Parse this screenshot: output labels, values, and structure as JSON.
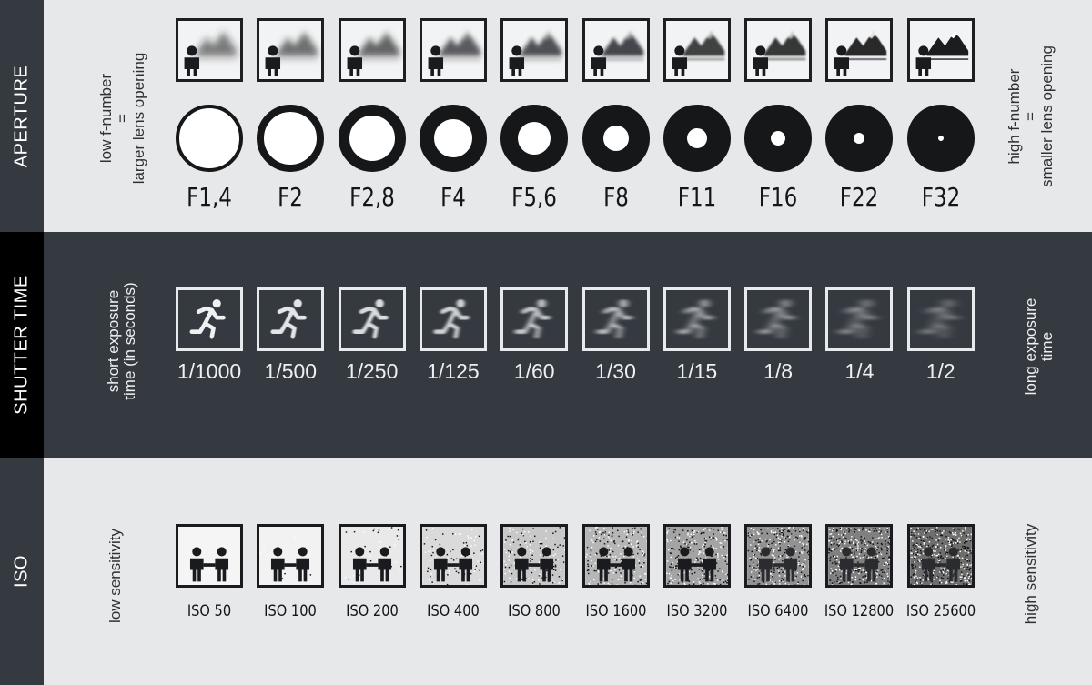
{
  "aperture": {
    "title": "APERTURE",
    "left_note": [
      "low f-number",
      "=",
      "larger lens opening"
    ],
    "right_note": [
      "high f-number",
      "=",
      "smaller lens opening"
    ],
    "stops": [
      {
        "label": "F1,4",
        "blur": 0.95,
        "ring": 0.06
      },
      {
        "label": "F2",
        "blur": 0.85,
        "ring": 0.12
      },
      {
        "label": "F2,8",
        "blur": 0.75,
        "ring": 0.17
      },
      {
        "label": "F4",
        "blur": 0.65,
        "ring": 0.22
      },
      {
        "label": "F5,6",
        "blur": 0.55,
        "ring": 0.27
      },
      {
        "label": "F8",
        "blur": 0.45,
        "ring": 0.32
      },
      {
        "label": "F11",
        "blur": 0.35,
        "ring": 0.36
      },
      {
        "label": "F16",
        "blur": 0.25,
        "ring": 0.4
      },
      {
        "label": "F22",
        "blur": 0.12,
        "ring": 0.43
      },
      {
        "label": "F32",
        "blur": 0.0,
        "ring": 0.46
      }
    ]
  },
  "shutter": {
    "title": "SHUTTER TIME",
    "left_note": [
      "short exposure",
      "time (in seconds)"
    ],
    "right_note": [
      "long exposure",
      "time"
    ],
    "speeds": [
      {
        "label": "1/1000",
        "blur": 0.0
      },
      {
        "label": "1/500",
        "blur": 0.1
      },
      {
        "label": "1/250",
        "blur": 0.2
      },
      {
        "label": "1/125",
        "blur": 0.3
      },
      {
        "label": "1/60",
        "blur": 0.42
      },
      {
        "label": "1/30",
        "blur": 0.55
      },
      {
        "label": "1/15",
        "blur": 0.68
      },
      {
        "label": "1/8",
        "blur": 0.8
      },
      {
        "label": "1/4",
        "blur": 0.9
      },
      {
        "label": "1/2",
        "blur": 1.0
      }
    ]
  },
  "iso": {
    "title": "ISO",
    "left_note": [
      "low sensitivity"
    ],
    "right_note": [
      "high sensitivity"
    ],
    "values": [
      {
        "label": "ISO 50",
        "noise": 0.0
      },
      {
        "label": "ISO 100",
        "noise": 0.02
      },
      {
        "label": "ISO 200",
        "noise": 0.08
      },
      {
        "label": "ISO 400",
        "noise": 0.18
      },
      {
        "label": "ISO 800",
        "noise": 0.3
      },
      {
        "label": "ISO 1600",
        "noise": 0.42
      },
      {
        "label": "ISO 3200",
        "noise": 0.54
      },
      {
        "label": "ISO 6400",
        "noise": 0.66
      },
      {
        "label": "ISO 12800",
        "noise": 0.78
      },
      {
        "label": "ISO 25600",
        "noise": 0.9
      }
    ]
  },
  "colors": {
    "dark_band": "#353a40",
    "light_band": "#e6e8ea",
    "black_tab": "#000000"
  }
}
